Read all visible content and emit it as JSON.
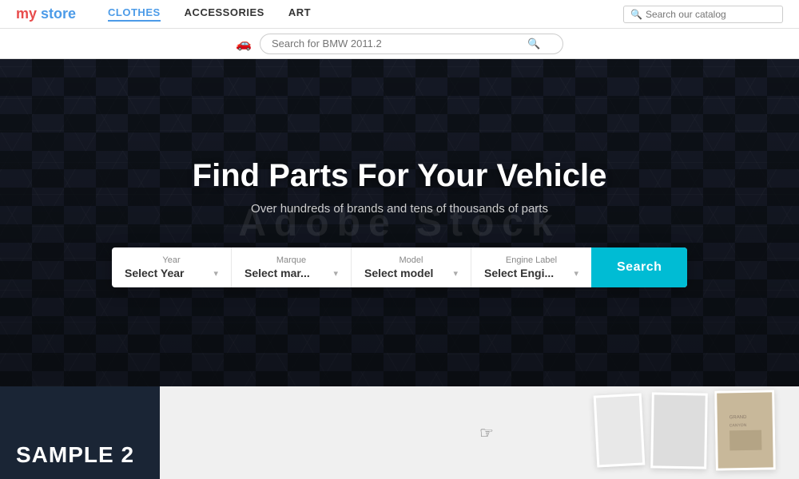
{
  "header": {
    "logo_my": "my",
    "logo_store": "store",
    "nav_items": [
      {
        "label": "CLOTHES",
        "active": true
      },
      {
        "label": "ACCESSORIES",
        "active": false
      },
      {
        "label": "ART",
        "active": false
      }
    ],
    "search_placeholder": "Search our catalog"
  },
  "secondary_bar": {
    "search_placeholder": "Search for BMW 2011.2"
  },
  "hero": {
    "title": "Find Parts For Your Vehicle",
    "subtitle": "Over hundreds of brands and tens of thousands of parts",
    "watermark": "Adobe Stock"
  },
  "vehicle_form": {
    "year_label": "Year",
    "year_value": "Select Year",
    "marque_label": "Marque",
    "marque_value": "Select mar...",
    "model_label": "Model",
    "model_value": "Select model",
    "engine_label": "Engine Label",
    "engine_value": "Select Engi...",
    "search_btn": "Search"
  },
  "bottom": {
    "sample_label": "SAMPLE 2"
  },
  "icons": {
    "search": "🔍",
    "car": "🚗",
    "chevron_down": "▾"
  }
}
